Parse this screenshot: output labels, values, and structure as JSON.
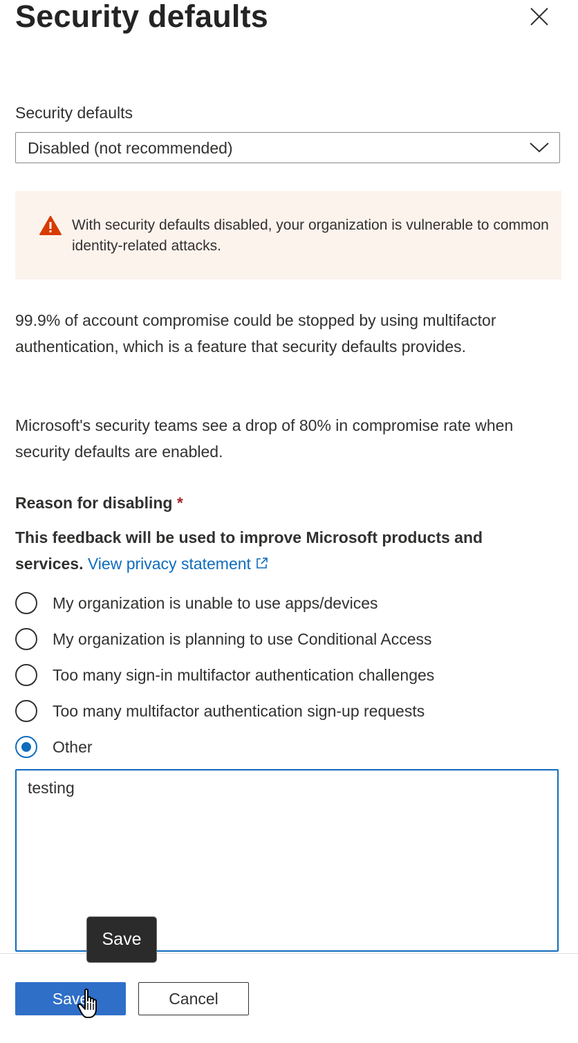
{
  "panel": {
    "title": "Security defaults",
    "close_icon": "close-icon"
  },
  "security_defaults": {
    "label": "Security defaults",
    "selected": "Disabled (not recommended)",
    "chevron_icon": "chevron-down-icon"
  },
  "warning": {
    "icon": "warning-icon",
    "color": "#d83b01",
    "background": "#fdf3ed",
    "text": "With security defaults disabled, your organization is vulnerable to common identity-related attacks."
  },
  "info": {
    "para1": "99.9% of account compromise could be stopped by using multifactor authentication, which is a feature that security defaults provides.",
    "para2": "Microsoft's security teams see a drop of 80% in compromise rate when security defaults are enabled."
  },
  "reason": {
    "heading": "Reason for disabling",
    "required_marker": "*",
    "note": "This feedback will be used to improve Microsoft products and services.",
    "privacy_link": "View privacy statement",
    "privacy_link_icon": "external-link-icon",
    "options": [
      {
        "label": "My organization is unable to use apps/devices",
        "checked": false
      },
      {
        "label": "My organization is planning to use Conditional Access",
        "checked": false
      },
      {
        "label": "Too many sign-in multifactor authentication challenges",
        "checked": false
      },
      {
        "label": "Too many multifactor authentication sign-up requests",
        "checked": false
      },
      {
        "label": "Other",
        "checked": true
      }
    ],
    "other_text": "testing"
  },
  "footer": {
    "save_label": "Save",
    "cancel_label": "Cancel",
    "tooltip": "Save"
  },
  "colors": {
    "accent": "#0f6cbd",
    "primary_button": "#2f6fc8",
    "required": "#a4262c"
  }
}
